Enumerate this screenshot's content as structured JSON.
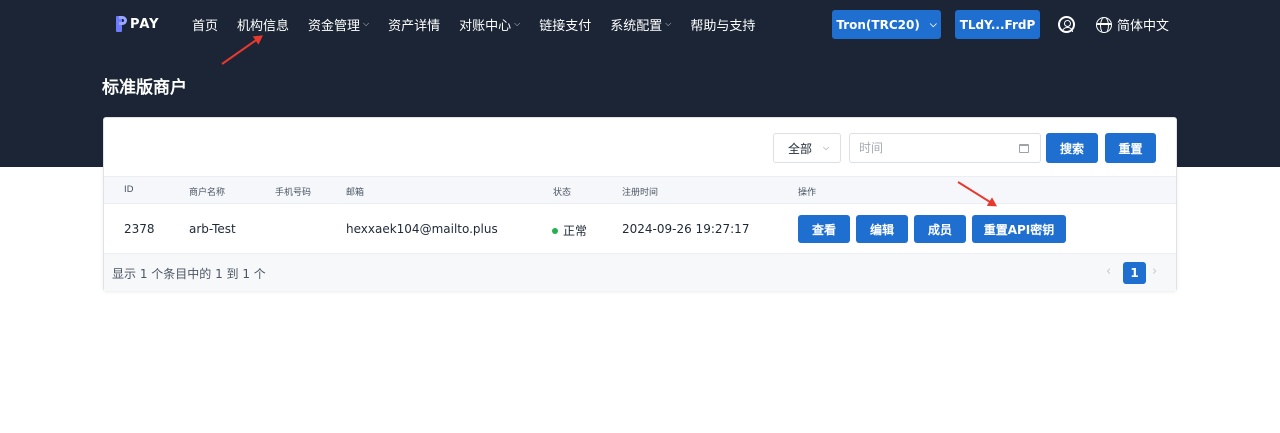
{
  "brand": {
    "name": "PAY"
  },
  "nav": {
    "items": [
      {
        "label": "首页",
        "dropdown": false
      },
      {
        "label": "机构信息",
        "dropdown": false
      },
      {
        "label": "资金管理",
        "dropdown": true
      },
      {
        "label": "资产详情",
        "dropdown": false
      },
      {
        "label": "对账中心",
        "dropdown": true
      },
      {
        "label": "链接支付",
        "dropdown": false
      },
      {
        "label": "系统配置",
        "dropdown": true
      },
      {
        "label": "帮助与支持",
        "dropdown": false
      }
    ],
    "chain_select": "Tron(TRC20)",
    "address": "TLdY...FrdP",
    "language": "简体中文"
  },
  "page": {
    "title": "标准版商户"
  },
  "filters": {
    "status_select": "全部",
    "time_placeholder": "时间",
    "search_label": "搜索",
    "reset_label": "重置"
  },
  "table": {
    "headers": [
      "ID",
      "商户名称",
      "手机号码",
      "邮箱",
      "状态",
      "注册时间",
      "操作"
    ],
    "rows": [
      {
        "id": "2378",
        "name": "arb-Test",
        "phone": "",
        "email": "hexxaek104@mailto.plus",
        "status": "正常",
        "registered": "2024-09-26 19:27:17",
        "actions": [
          "查看",
          "编辑",
          "成员",
          "重置API密钥"
        ]
      }
    ]
  },
  "pagination": {
    "summary": "显示 1 个条目中的 1 到 1 个",
    "current_page": "1"
  },
  "colors": {
    "header_bg": "#1b2535",
    "accent": "#1f6fd1",
    "status_ok": "#22b14c",
    "annotation_arrow": "#e8392f"
  }
}
